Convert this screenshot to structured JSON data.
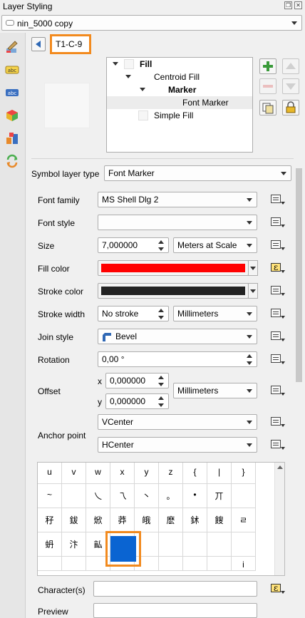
{
  "window": {
    "title": "Layer Styling"
  },
  "layer_selector": {
    "value": "nin_5000 copy"
  },
  "symbol_name": "T1-C-9",
  "tree": {
    "items": [
      {
        "label": "Fill",
        "bold": true
      },
      {
        "label": "Centroid Fill",
        "bold": false
      },
      {
        "label": "Marker",
        "bold": true
      },
      {
        "label": "Font Marker",
        "bold": false
      },
      {
        "label": "Simple Fill",
        "bold": false
      }
    ]
  },
  "symbol_layer_type": {
    "label": "Symbol layer type",
    "value": "Font Marker"
  },
  "font_family": {
    "label": "Font family",
    "value": "MS Shell Dlg 2"
  },
  "font_style": {
    "label": "Font style",
    "value": ""
  },
  "size": {
    "label": "Size",
    "value": "7,000000",
    "unit": "Meters at Scale"
  },
  "fill_color": {
    "label": "Fill color",
    "color": "#ff0000"
  },
  "stroke_color": {
    "label": "Stroke color",
    "color": "#232323"
  },
  "stroke_width": {
    "label": "Stroke width",
    "value": "No stroke",
    "unit": "Millimeters"
  },
  "join_style": {
    "label": "Join style",
    "value": "Bevel"
  },
  "rotation": {
    "label": "Rotation",
    "value": "0,00 °"
  },
  "offset": {
    "label": "Offset",
    "x_label": "x",
    "x_value": "0,000000",
    "y_label": "y",
    "y_value": "0,000000",
    "unit": "Millimeters"
  },
  "anchor": {
    "label": "Anchor point",
    "vertical": "VCenter",
    "horizontal": "HCenter"
  },
  "glyphs": {
    "rows": [
      [
        "u",
        "v",
        "w",
        "x",
        "y",
        "z",
        "{",
        "|",
        "}"
      ],
      [
        "~",
        "",
        "乀",
        "乁",
        "丶",
        "。",
        "•",
        "丌",
        ""
      ],
      [
        "秄",
        "鈸",
        "焮",
        "莽",
        "皒",
        "麽",
        "鉥",
        "餿",
        "ㄹ"
      ],
      [
        "蚒",
        "汴",
        "畆",
        "",
        "",
        "",
        "",
        "",
        ""
      ],
      [
        "",
        "",
        "",
        "",
        "",
        "",
        "",
        "",
        "i"
      ]
    ],
    "selected_color": "#0a64d2"
  },
  "characters": {
    "label": "Character(s)",
    "value": ""
  },
  "preview_field": {
    "label": "Preview"
  },
  "colors": {
    "highlight": "#f28a1e",
    "accent": "#2f68b5"
  }
}
